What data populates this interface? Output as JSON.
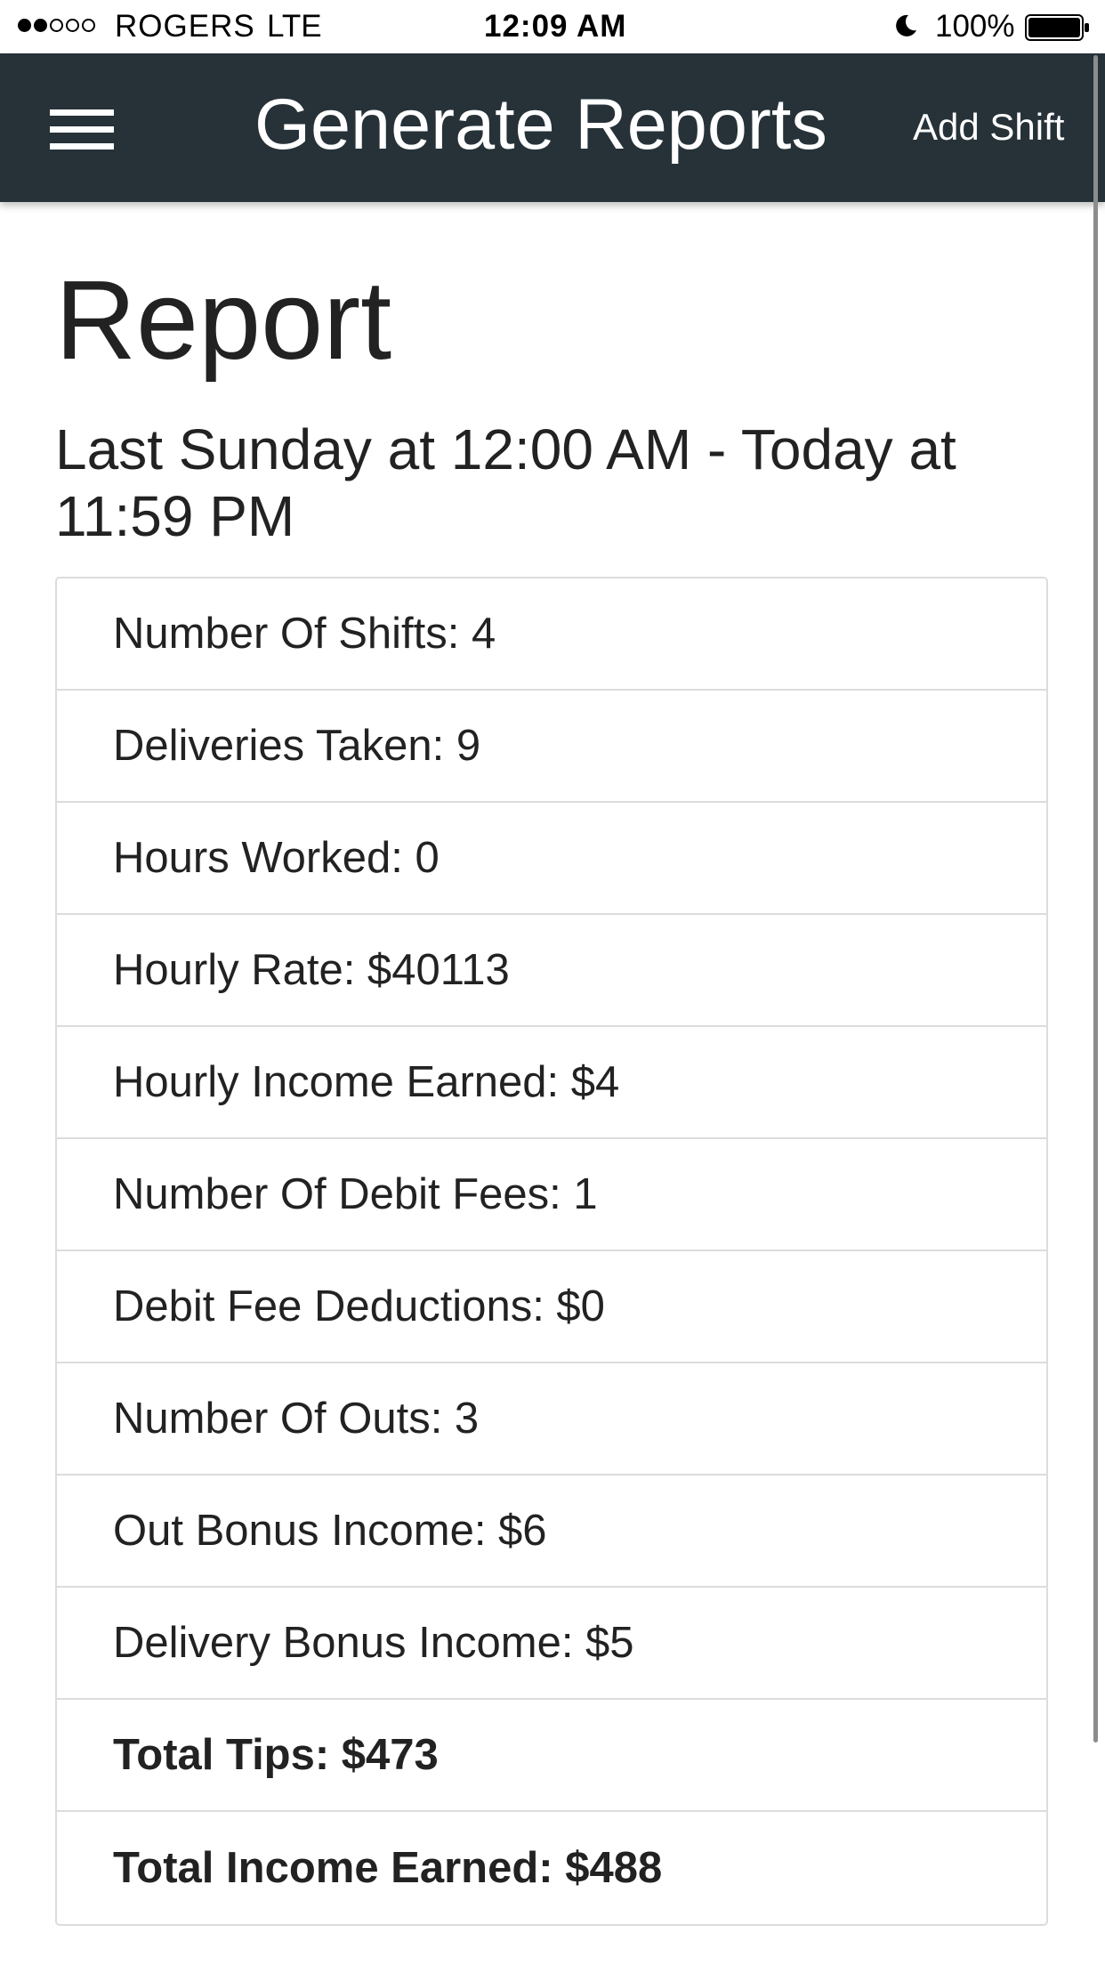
{
  "status_bar": {
    "carrier": "ROGERS",
    "network": "LTE",
    "time": "12:09 AM",
    "battery": "100%",
    "signal_bars_filled": 2,
    "signal_bars_total": 5,
    "icons": [
      "moon-icon",
      "battery-icon"
    ]
  },
  "app_bar": {
    "menu_icon": "hamburger-menu-icon",
    "title": "Generate Reports",
    "add_shift_label": "Add Shift",
    "background_color": "#263238"
  },
  "content": {
    "title": "Report",
    "date_range": "Last Sunday at 12:00 AM - Today at 11:59 PM",
    "rows": [
      {
        "label": "Number Of Shifts: 4",
        "bold": false
      },
      {
        "label": "Deliveries Taken: 9",
        "bold": false
      },
      {
        "label": "Hours Worked: 0",
        "bold": false
      },
      {
        "label": "Hourly Rate: $40113",
        "bold": false
      },
      {
        "label": "Hourly Income Earned: $4",
        "bold": false
      },
      {
        "label": "Number Of Debit Fees: 1",
        "bold": false
      },
      {
        "label": "Debit Fee Deductions: $0",
        "bold": false
      },
      {
        "label": "Number Of Outs: 3",
        "bold": false
      },
      {
        "label": "Out Bonus Income: $6",
        "bold": false
      },
      {
        "label": "Delivery Bonus Income: $5",
        "bold": false
      },
      {
        "label": "Total Tips: $473",
        "bold": true
      },
      {
        "label": "Total Income Earned: $488",
        "bold": true
      }
    ]
  }
}
